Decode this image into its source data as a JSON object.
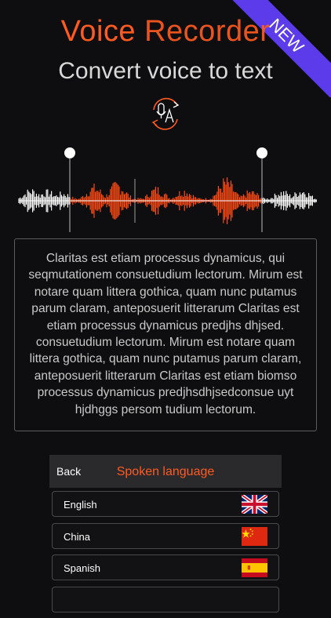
{
  "badge": {
    "label": "NEW",
    "color": "#5b3bea"
  },
  "header": {
    "title_part1": "Voice",
    "title_part2": "Recorder",
    "subtitle": "Convert voice to text",
    "icon": "voice-to-text-icon"
  },
  "waveform": {
    "selected_color": "#ff4a10",
    "unselected_color": "#ffffff"
  },
  "transcript": {
    "text": "Claritas est etiam processus dynamicus, qui seqmutationem consuetudium lectorum. Mirum est notare quam littera gothica, quam nunc putamus parum claram, anteposuerit litterarum Claritas est etiam processus dynamicus predjhs dhjsed. consuetudium lectorum. Mirum est notare quam littera gothica, quam nunc putamus parum claram, anteposuerit litterarum Claritas est etiam biomso processus dynamicus predjhsdhjsedconsue uyt hjdhggs persom tudium lectorum."
  },
  "language_panel": {
    "back_label": "Back",
    "title": "Spoken language",
    "languages": [
      {
        "label": "English",
        "flag": "uk-flag-icon"
      },
      {
        "label": "China",
        "flag": "china-flag-icon"
      },
      {
        "label": "Spanish",
        "flag": "spain-flag-icon"
      }
    ]
  },
  "colors": {
    "accent": "#ff5a1f",
    "background": "#0e0e10"
  }
}
